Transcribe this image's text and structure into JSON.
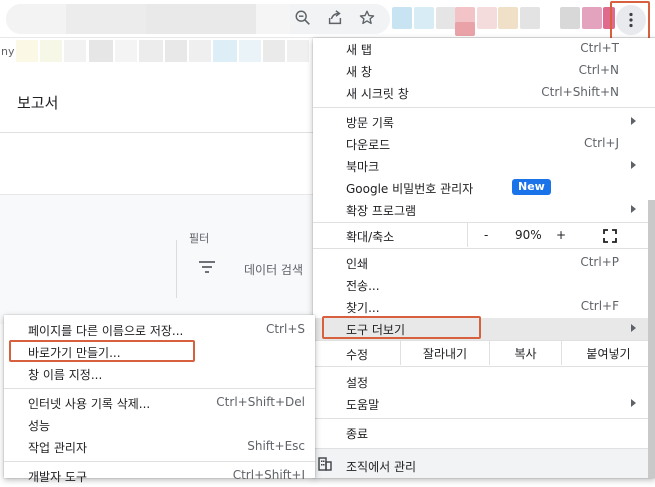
{
  "bookmarks": {
    "partial_text": "ny"
  },
  "page": {
    "title": "보고서",
    "filter_label": "필터",
    "filter_placeholder": "데이터 검색"
  },
  "main_menu": {
    "new_tab": {
      "label": "새 탭",
      "shortcut": "Ctrl+T"
    },
    "new_window": {
      "label": "새 창",
      "shortcut": "Ctrl+N"
    },
    "incognito": {
      "label": "새 시크릿 창",
      "shortcut": "Ctrl+Shift+N"
    },
    "history": {
      "label": "방문 기록"
    },
    "downloads": {
      "label": "다운로드",
      "shortcut": "Ctrl+J"
    },
    "bookmarks": {
      "label": "북마크"
    },
    "passwords": {
      "label": "Google 비밀번호 관리자",
      "badge": "New"
    },
    "extensions": {
      "label": "확장 프로그램"
    },
    "zoom": {
      "label": "확대/축소",
      "minus": "-",
      "value": "90%",
      "plus": "+"
    },
    "print": {
      "label": "인쇄",
      "shortcut": "Ctrl+P"
    },
    "cast": {
      "label": "전송..."
    },
    "find": {
      "label": "찾기...",
      "shortcut": "Ctrl+F"
    },
    "more_tools": {
      "label": "도구 더보기"
    },
    "edit": {
      "label": "수정",
      "cut": "잘라내기",
      "copy": "복사",
      "paste": "붙여넣기"
    },
    "settings": {
      "label": "설정"
    },
    "help": {
      "label": "도움말"
    },
    "exit": {
      "label": "종료"
    },
    "managed": {
      "label": "조직에서 관리"
    }
  },
  "sub_menu": {
    "save_page": {
      "label": "페이지를 다른 이름으로 저장...",
      "shortcut": "Ctrl+S"
    },
    "create_shortcut": {
      "label": "바로가기 만들기..."
    },
    "name_window": {
      "label": "창 이름 지정..."
    },
    "clear_data": {
      "label": "인터넷 사용 기록 삭제...",
      "shortcut": "Ctrl+Shift+Del"
    },
    "performance": {
      "label": "성능"
    },
    "task_manager": {
      "label": "작업 관리자",
      "shortcut": "Shift+Esc"
    },
    "dev_tools": {
      "label": "개발자 도구",
      "shortcut": "Ctrl+Shift+I"
    }
  },
  "colors": {
    "highlight_box": "#d7613e",
    "new_badge": "#1a73e8",
    "menu_hover": "#e8e8e8"
  }
}
